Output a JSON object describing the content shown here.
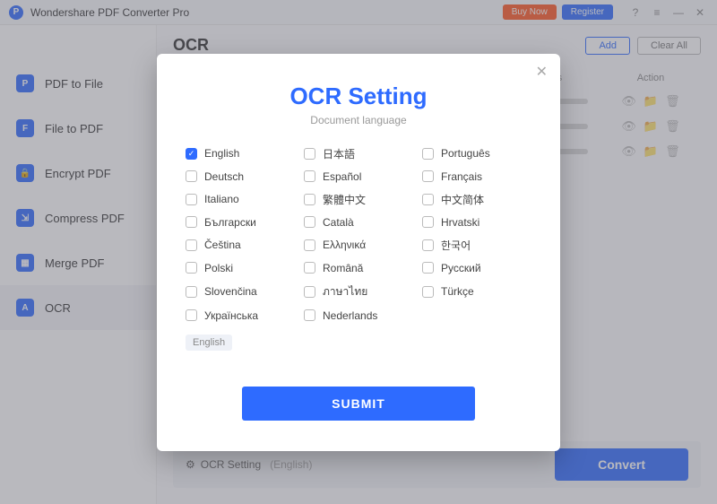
{
  "titlebar": {
    "app_name": "Wondershare PDF Converter Pro",
    "buy": "Buy Now",
    "register": "Register"
  },
  "sidebar": {
    "items": [
      {
        "label": "PDF to File",
        "icon": "P"
      },
      {
        "label": "File to PDF",
        "icon": "F"
      },
      {
        "label": "Encrypt PDF",
        "icon": "🔒"
      },
      {
        "label": "Compress PDF",
        "icon": "⇲"
      },
      {
        "label": "Merge PDF",
        "icon": "▦"
      },
      {
        "label": "OCR",
        "icon": "A"
      }
    ],
    "selected_index": 5
  },
  "main": {
    "title": "OCR",
    "add": "Add",
    "clear": "Clear All",
    "col_status": "Status",
    "col_action": "Action"
  },
  "bottom": {
    "ocr_setting_label": "OCR Setting",
    "ocr_lang": "(English)",
    "convert": "Convert"
  },
  "dialog": {
    "title": "OCR Setting",
    "subtitle": "Document language",
    "languages": [
      {
        "label": "English",
        "checked": true
      },
      {
        "label": "日本語",
        "checked": false
      },
      {
        "label": "Português",
        "checked": false
      },
      {
        "label": "Deutsch",
        "checked": false
      },
      {
        "label": "Español",
        "checked": false
      },
      {
        "label": "Français",
        "checked": false
      },
      {
        "label": "Italiano",
        "checked": false
      },
      {
        "label": "繁體中文",
        "checked": false
      },
      {
        "label": "中文简体",
        "checked": false
      },
      {
        "label": "Български",
        "checked": false
      },
      {
        "label": "Català",
        "checked": false
      },
      {
        "label": "Hrvatski",
        "checked": false
      },
      {
        "label": "Čeština",
        "checked": false
      },
      {
        "label": "Ελληνικά",
        "checked": false
      },
      {
        "label": "한국어",
        "checked": false
      },
      {
        "label": "Polski",
        "checked": false
      },
      {
        "label": "Română",
        "checked": false
      },
      {
        "label": "Русский",
        "checked": false
      },
      {
        "label": "Slovenčina",
        "checked": false
      },
      {
        "label": "ภาษาไทย",
        "checked": false
      },
      {
        "label": "Türkçe",
        "checked": false
      },
      {
        "label": "Українська",
        "checked": false
      },
      {
        "label": "Nederlands",
        "checked": false
      }
    ],
    "selected_chip": "English",
    "submit": "SUBMIT"
  }
}
